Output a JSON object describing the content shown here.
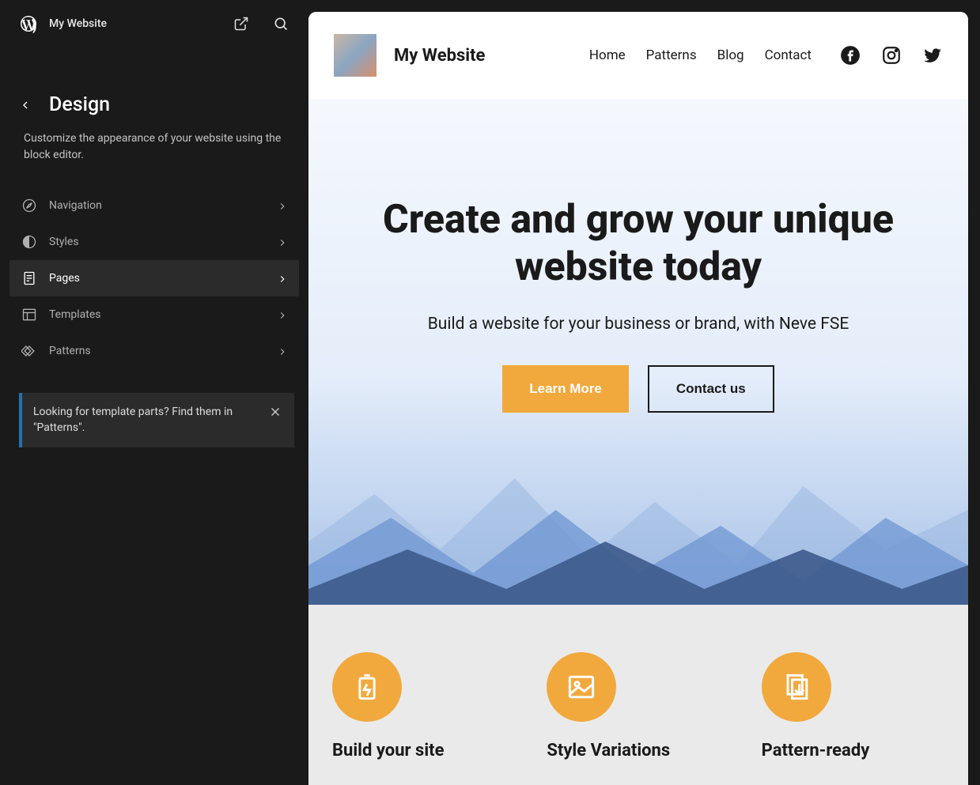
{
  "sidebar": {
    "site_title": "My Website",
    "section_title": "Design",
    "section_desc": "Customize the appearance of your website using the block editor.",
    "menu": [
      {
        "label": "Navigation",
        "icon": "compass"
      },
      {
        "label": "Styles",
        "icon": "contrast"
      },
      {
        "label": "Pages",
        "icon": "page"
      },
      {
        "label": "Templates",
        "icon": "layout"
      },
      {
        "label": "Patterns",
        "icon": "diamond"
      }
    ],
    "notice": "Looking for template parts? Find them in \"Patterns\"."
  },
  "site": {
    "name": "My Website",
    "nav": [
      "Home",
      "Patterns",
      "Blog",
      "Contact"
    ],
    "hero": {
      "title": "Create and grow your unique website today",
      "subtitle": "Build a website for your business or brand, with Neve FSE",
      "primary_btn": "Learn More",
      "secondary_btn": "Contact us"
    },
    "features": [
      {
        "title": "Build your site"
      },
      {
        "title": "Style Variations"
      },
      {
        "title": "Pattern-ready"
      }
    ]
  }
}
